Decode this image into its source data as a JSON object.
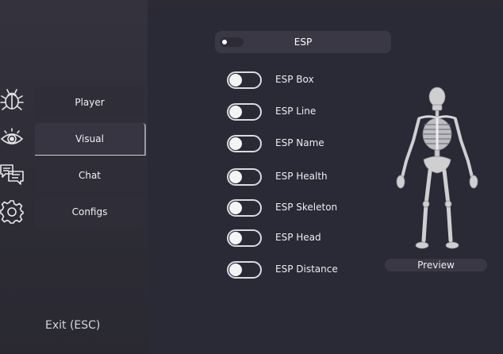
{
  "nav": {
    "items": [
      {
        "label": "Player",
        "icon": "bug-icon"
      },
      {
        "label": "Visual",
        "icon": "eye-icon"
      },
      {
        "label": "Chat",
        "icon": "chat-icon"
      },
      {
        "label": "Configs",
        "icon": "gear-icon"
      }
    ],
    "active": "Visual",
    "exit_label": "Exit (ESC)"
  },
  "esp": {
    "header_label": "ESP",
    "options": [
      {
        "label": "ESP Box",
        "enabled": false
      },
      {
        "label": "ESP Line",
        "enabled": false
      },
      {
        "label": "ESP Name",
        "enabled": false
      },
      {
        "label": "ESP Health",
        "enabled": false
      },
      {
        "label": "ESP Skeleton",
        "enabled": false
      },
      {
        "label": "ESP Head",
        "enabled": false
      },
      {
        "label": "ESP Distance",
        "enabled": false
      }
    ]
  },
  "preview": {
    "label": "Preview",
    "image": "skeleton-figure"
  },
  "colors": {
    "background": "#2b2a35",
    "panel": "#393844",
    "toggle_border": "#dadae0",
    "text": "#ffffff"
  }
}
